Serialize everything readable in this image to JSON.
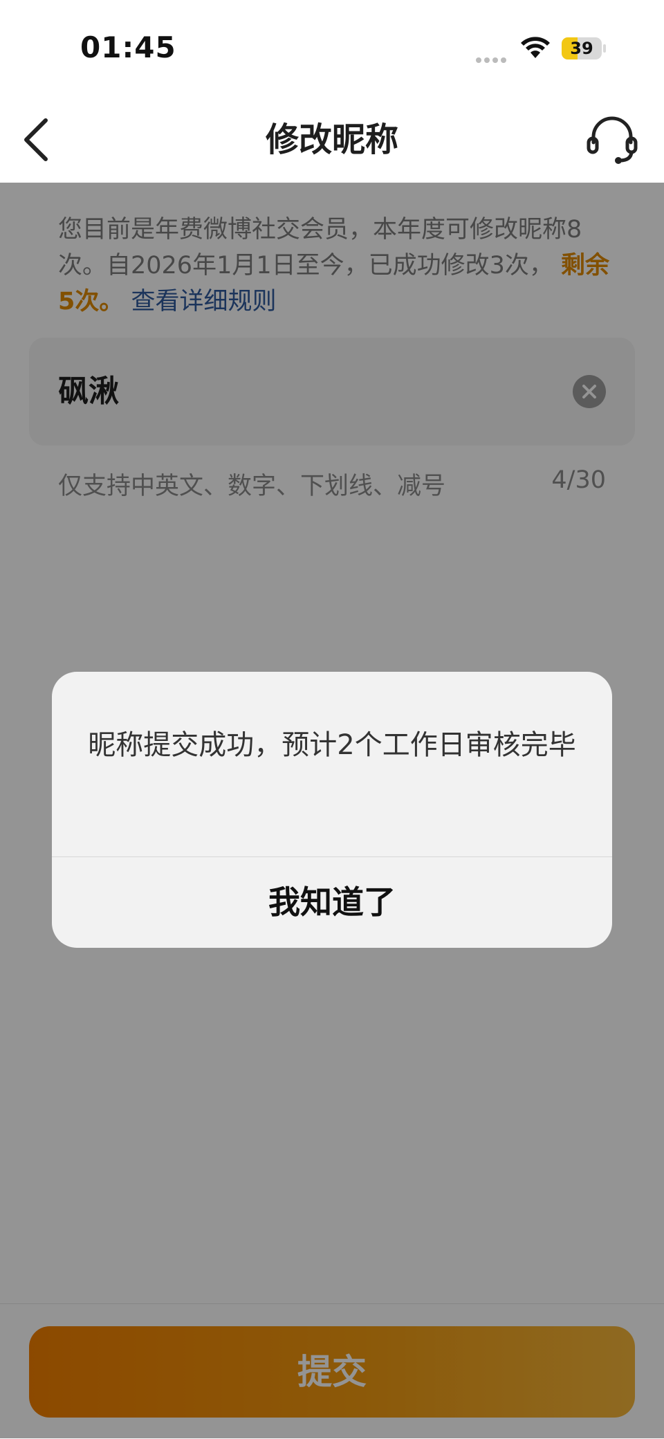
{
  "status_bar": {
    "time": "01:45",
    "battery_text": "39",
    "battery_level": 0.39,
    "battery_color": "#f2c714"
  },
  "nav": {
    "title": "修改昵称",
    "back_icon": "chevron-left-icon",
    "service_icon": "headset-icon"
  },
  "notice": {
    "text_prefix": "您目前是年费微博社交会员，本年度可修改昵称8次。自2026年1月1日至今，已成功修改3次，",
    "remaining": "剩余5次。",
    "rules_link": "查看详细规则",
    "highlight_color": "#e08a00",
    "link_color": "#2f5a9e"
  },
  "nickname_input": {
    "value": "砜湫",
    "clear_icon": "clear-icon"
  },
  "hint": {
    "text": "仅支持中英文、数字、下划线、减号",
    "counter": "4/30"
  },
  "submit": {
    "label": "提交",
    "color": "#f27f00"
  },
  "dialog": {
    "message": "昵称提交成功，预计2个工作日审核完毕",
    "confirm_label": "我知道了"
  }
}
